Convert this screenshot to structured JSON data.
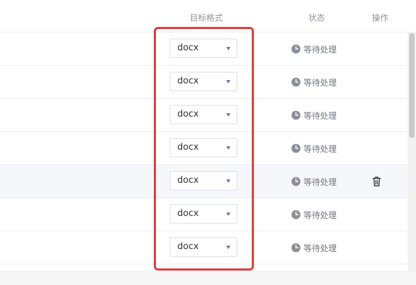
{
  "table": {
    "columns": {
      "format": "目标格式",
      "status": "状态",
      "actions": "操作"
    },
    "rows": [
      {
        "format": "docx",
        "status": "等待处理"
      },
      {
        "format": "docx",
        "status": "等待处理"
      },
      {
        "format": "docx",
        "status": "等待处理"
      },
      {
        "format": "docx",
        "status": "等待处理"
      },
      {
        "format": "docx",
        "status": "等待处理",
        "hovered": true,
        "action_icon": "trash-icon"
      },
      {
        "format": "docx",
        "status": "等待处理"
      },
      {
        "format": "docx",
        "status": "等待处理"
      }
    ]
  },
  "colors": {
    "highlight": "#e53935",
    "row_hover": "#f5f7fa",
    "caret": "#7a6fa8",
    "status_icon": "#8a8f99"
  },
  "icons": {
    "status": "clock-icon",
    "dropdown": "caret-down-icon",
    "delete": "trash-icon"
  }
}
